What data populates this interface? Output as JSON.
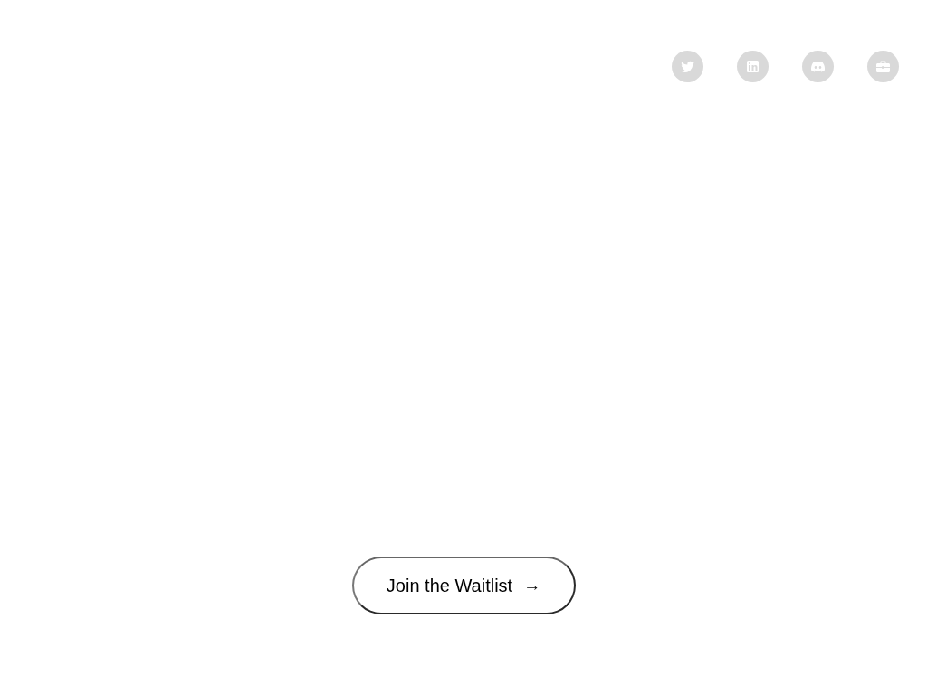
{
  "social_links": [
    {
      "kind": "bird"
    },
    {
      "kind": "in"
    },
    {
      "kind": "gamepad"
    },
    {
      "kind": "briefcase"
    }
  ],
  "cta_button": {
    "label": "Join the Waitlist",
    "arrow": "→"
  }
}
